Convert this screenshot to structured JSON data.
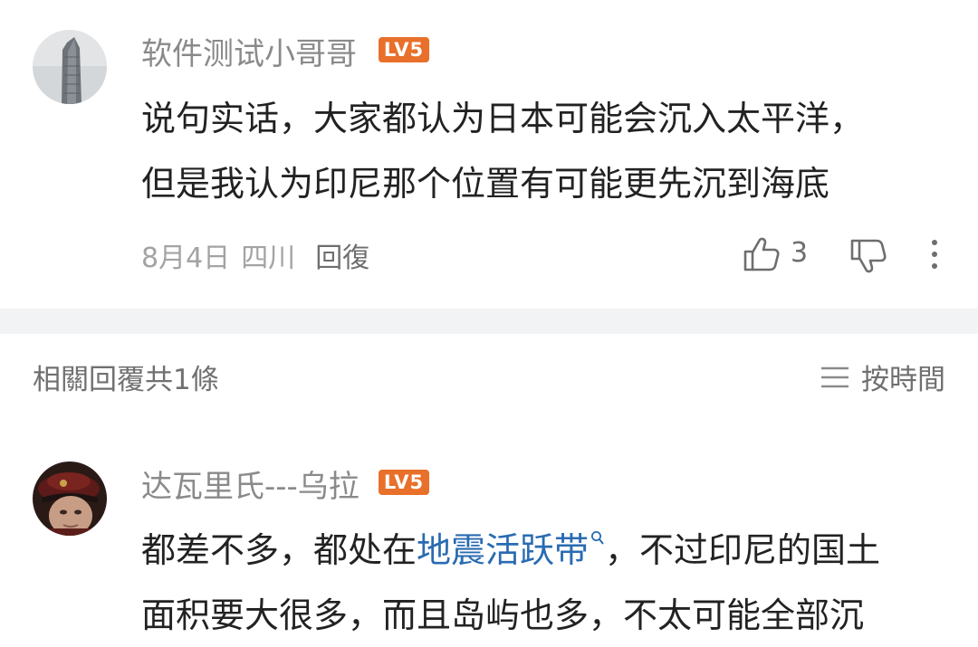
{
  "comment": {
    "username": "软件测试小哥哥",
    "level_badge": "LV5",
    "body_lines": [
      "说句实话，大家都认为日本可能会沉入太平洋，",
      "但是我认为印尼那个位置有可能更先沉到海底"
    ],
    "date": "8月4日",
    "location": "四川",
    "reply_label": "回復",
    "like_count": "3"
  },
  "replies_section": {
    "header": "相關回覆共1條",
    "sort_label": "按時間"
  },
  "reply": {
    "username": "达瓦里氏---乌拉",
    "level_badge": "LV5",
    "line1_before": "都差不多，都处在",
    "line1_link": "地震活跃带",
    "line1_after": "，不过印尼的国土",
    "line2": "面积要大很多，而且岛屿也多，不太可能全部沉"
  },
  "colors": {
    "badge": "#e8702a",
    "link": "#2a6bb2",
    "divider": "#f2f3f5"
  }
}
